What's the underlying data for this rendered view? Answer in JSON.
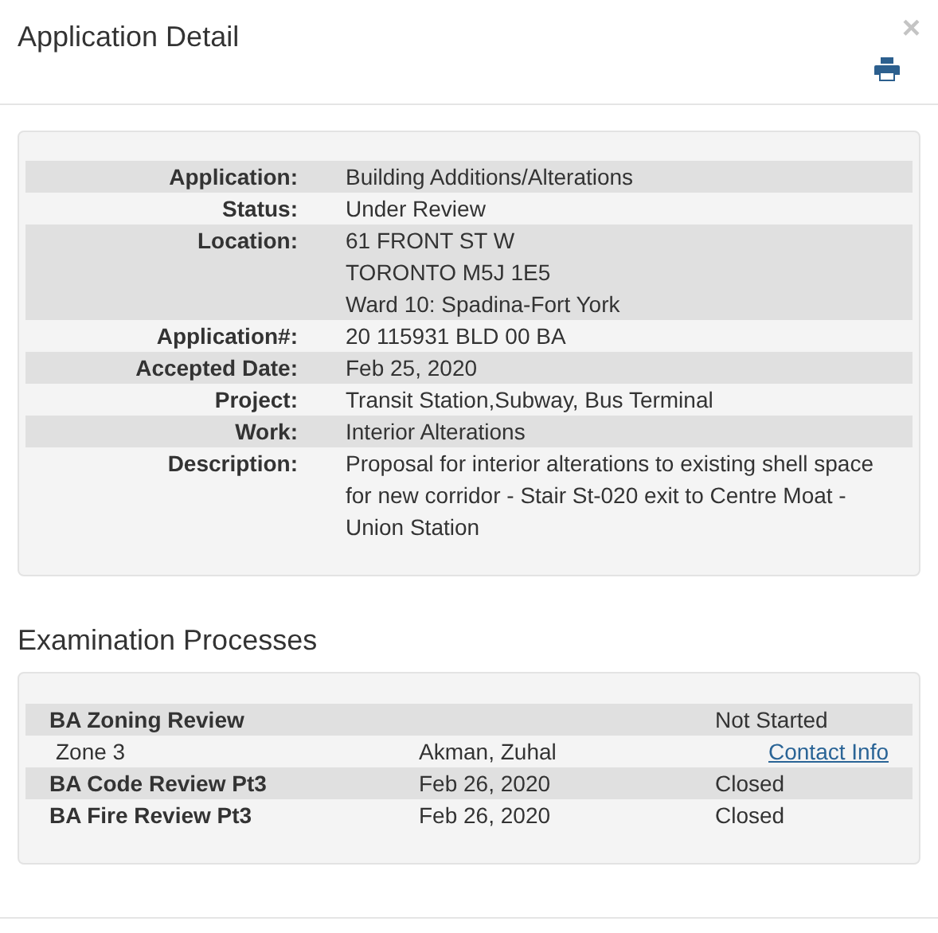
{
  "modal": {
    "title": "Application Detail",
    "close": "×"
  },
  "details": [
    {
      "label": "Application:",
      "lines": [
        "Building Additions/Alterations"
      ]
    },
    {
      "label": "Status:",
      "lines": [
        "Under Review"
      ]
    },
    {
      "label": "Location:",
      "lines": [
        "61 FRONT ST W",
        "TORONTO M5J 1E5",
        "Ward 10: Spadina-Fort York"
      ]
    },
    {
      "label": "Application#:",
      "lines": [
        "20 115931 BLD 00 BA"
      ]
    },
    {
      "label": "Accepted Date:",
      "lines": [
        "Feb 25, 2020"
      ]
    },
    {
      "label": "Project:",
      "lines": [
        "Transit Station,Subway, Bus Terminal"
      ]
    },
    {
      "label": "Work:",
      "lines": [
        "Interior Alterations"
      ]
    },
    {
      "label": "Description:",
      "lines": [
        "Proposal for interior alterations to existing shell space for new corridor - Stair St-020 exit to Centre Moat - Union Station"
      ]
    }
  ],
  "examination": {
    "heading": "Examination Processes",
    "rows": [
      {
        "kind": "process",
        "name": "BA Zoning Review",
        "date": "",
        "status": "Not Started"
      },
      {
        "kind": "contact",
        "zone": "Zone 3",
        "examiner": "Akman, Zuhal",
        "link": "Contact Info"
      },
      {
        "kind": "process",
        "name": "BA Code Review Pt3",
        "date": "Feb 26, 2020",
        "status": "Closed"
      },
      {
        "kind": "process",
        "name": "BA Fire Review Pt3",
        "date": "Feb 26, 2020",
        "status": "Closed"
      }
    ]
  }
}
